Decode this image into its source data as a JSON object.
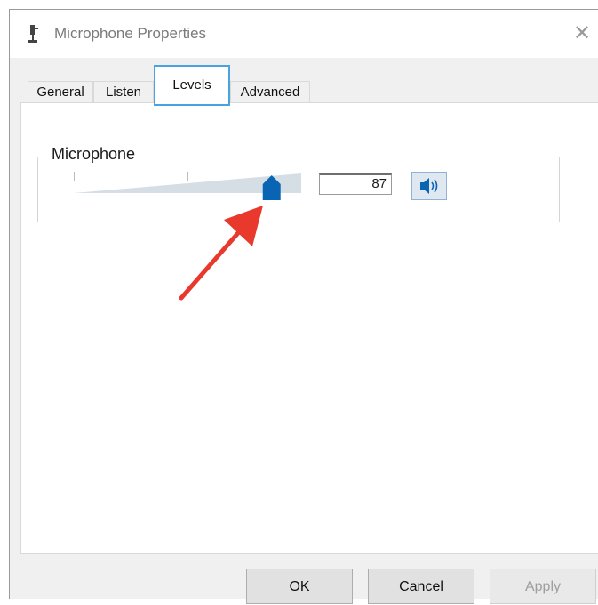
{
  "window": {
    "title": "Microphone Properties",
    "close_glyph": "✕",
    "icon": "microphone-icon"
  },
  "tabs": [
    {
      "label": "General"
    },
    {
      "label": "Listen"
    },
    {
      "label": "Levels",
      "active": true
    },
    {
      "label": "Advanced"
    }
  ],
  "levels": {
    "group_label": "Microphone",
    "value": "87",
    "slider_level": 0.87,
    "mute_icon": "speaker-icon"
  },
  "footer": {
    "ok_label": "OK",
    "cancel_label": "Cancel",
    "apply_label": "Apply"
  },
  "colors": {
    "accent": "#4aa3df",
    "slider_thumb": "#0a64b4",
    "arrow": "#e8392c"
  }
}
